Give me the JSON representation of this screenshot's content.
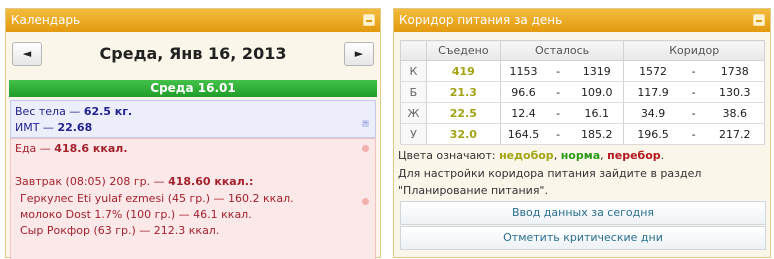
{
  "calendar": {
    "title": "Календарь",
    "prev_label": "◄",
    "next_label": "►",
    "date_title": "Среда, Янв 16, 2013",
    "day_label": "Среда 16.01",
    "weight": {
      "label": "Вес тела — ",
      "value": "62.5 кг."
    },
    "bmi": {
      "label": "ИМТ — ",
      "value": "22.68"
    },
    "food": {
      "label": "Еда — ",
      "value": "418.6 ккал."
    },
    "breakfast": {
      "label": "Завтрак (08:05) 208 гр. — ",
      "value": "418.60 ккал.:"
    },
    "items": [
      "Геркулес Eti yulaf ezmesi (45 гр.) — 160.2 ккал.",
      "молоко Dost 1.7% (100 гр.) — 46.1 ккал.",
      "Сыр Рокфор (63 гр.) — 212.3 ккал."
    ]
  },
  "corridor": {
    "title": "Коридор питания за день",
    "headers": [
      "",
      "Съедено",
      "Осталось",
      "Коридор"
    ],
    "rows": [
      {
        "label": "К",
        "eaten": "419",
        "left_min": "1153",
        "left_max": "1319",
        "corr_min": "1572",
        "corr_max": "1738"
      },
      {
        "label": "Б",
        "eaten": "21.3",
        "left_min": "96.6",
        "left_max": "109.0",
        "corr_min": "117.9",
        "corr_max": "130.3"
      },
      {
        "label": "Ж",
        "eaten": "22.5",
        "left_min": "12.4",
        "left_max": "16.1",
        "corr_min": "34.9",
        "corr_max": "38.6"
      },
      {
        "label": "У",
        "eaten": "32.0",
        "left_min": "164.5",
        "left_max": "185.2",
        "corr_min": "196.5",
        "corr_max": "217.2"
      }
    ],
    "dash": "-",
    "legend_prefix": "Цвета означают: ",
    "legend_under": "недобор",
    "legend_sep": ", ",
    "legend_norm": "норма",
    "legend_over": "перебор",
    "legend_end": ".",
    "info_line1": "Для настройки коридора питания зайдите в раздел",
    "info_line2": "\"Планирование питания\".",
    "btn_enter": "Ввод данных за сегодня",
    "btn_critical": "Отметить критические дни"
  },
  "colors": {
    "header": "#e39a0f",
    "day_bar": "#1f9d28",
    "under": "#a3a314",
    "norm": "#2a9a1b",
    "over": "#b5161d"
  }
}
